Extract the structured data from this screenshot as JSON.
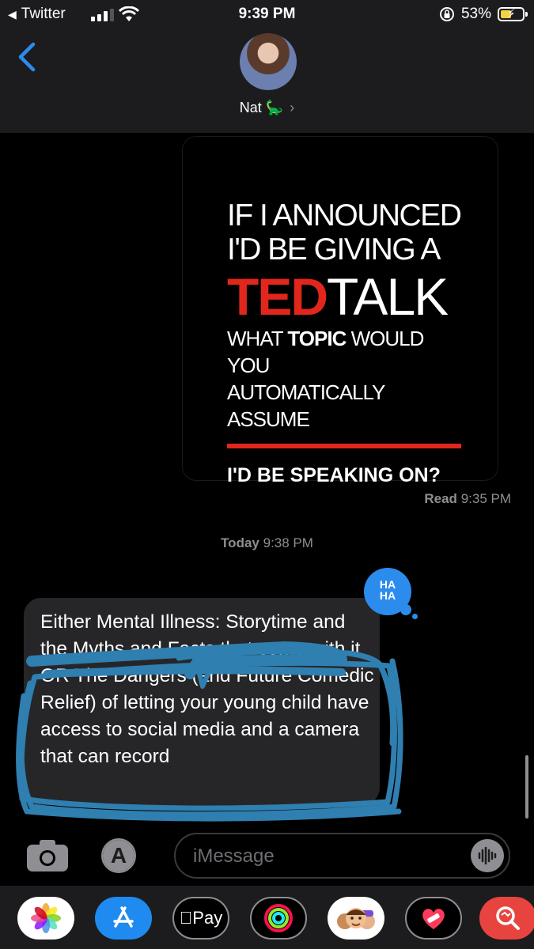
{
  "status_bar": {
    "back_app": "Twitter",
    "time": "9:39 PM",
    "battery_percent": "53%",
    "battery_level": 0.53
  },
  "header": {
    "contact_name": "Nat 🦕",
    "back_icon": "chevron-left-icon"
  },
  "thread": {
    "image_message": {
      "line1": "IF I ANNOUNCED",
      "line2": "I'D BE GIVING A",
      "ted_red": "TED",
      "ted_white": "TALK",
      "line4a": "WHAT ",
      "line4b": "TOPIC",
      "line4c": " WOULD YOU",
      "line5": "AUTOMATICALLY ASSUME",
      "line6": "I'D BE SPEAKING ON?"
    },
    "read_receipt_label": "Read",
    "read_receipt_time": "9:35 PM",
    "timestamp_day": "Today",
    "timestamp_time": "9:38 PM",
    "tapback_line1": "HA",
    "tapback_line2": "HA",
    "message_text": "Either Mental Illness: Storytime and the Myths and Facts that come with it OR The Dangers (and Future Comedic Relief) of letting your young child have access to social media and a camera that can record"
  },
  "input_bar": {
    "placeholder": "iMessage"
  },
  "app_drawer": {
    "apps": [
      "photos-icon",
      "app-store-icon",
      "apple-pay-icon",
      "activity-icon",
      "memoji-icon",
      "heart-sticker-icon",
      "search-images-icon"
    ],
    "pay_label": "Pay"
  },
  "colors": {
    "ted_red": "#e1261c",
    "tapback_blue": "#2b8cee",
    "scribble_blue": "#2f7fb0",
    "bubble_gray": "#262629"
  }
}
